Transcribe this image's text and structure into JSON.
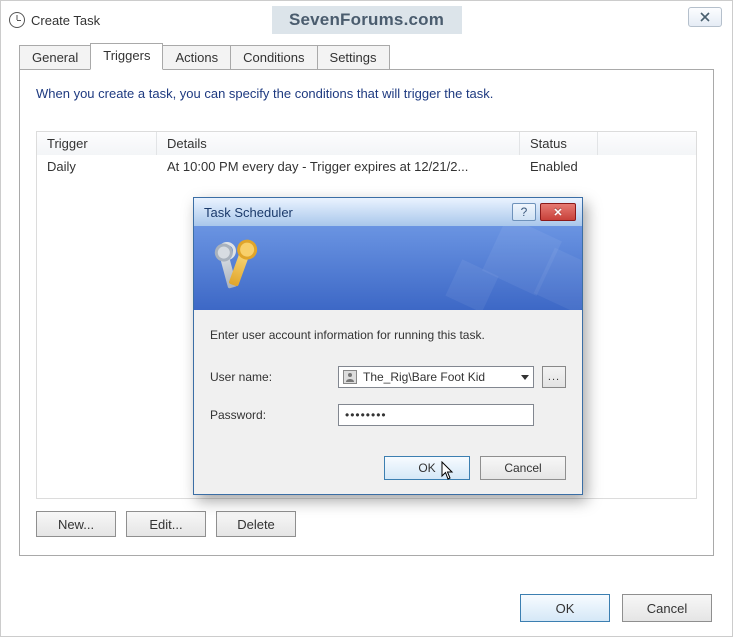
{
  "window": {
    "title": "Create Task",
    "watermark": "SevenForums.com"
  },
  "tabs": {
    "items": [
      {
        "label": "General"
      },
      {
        "label": "Triggers"
      },
      {
        "label": "Actions"
      },
      {
        "label": "Conditions"
      },
      {
        "label": "Settings"
      }
    ],
    "active_index": 1
  },
  "triggers": {
    "intro": "When you create a task, you can specify the conditions that will trigger the task.",
    "columns": {
      "c1": "Trigger",
      "c2": "Details",
      "c3": "Status"
    },
    "rows": [
      {
        "trigger": "Daily",
        "details": "At 10:00 PM every day - Trigger expires at 12/21/2...",
        "status": "Enabled"
      }
    ],
    "buttons": {
      "new": "New...",
      "edit": "Edit...",
      "delete": "Delete"
    }
  },
  "footer": {
    "ok": "OK",
    "cancel": "Cancel"
  },
  "dialog": {
    "title": "Task Scheduler",
    "message": "Enter user account information for running this task.",
    "username_label": "User name:",
    "username_value": "The_Rig\\Bare Foot Kid",
    "password_label": "Password:",
    "password_mask": "••••••••",
    "browse": "...",
    "ok": "OK",
    "cancel": "Cancel"
  }
}
